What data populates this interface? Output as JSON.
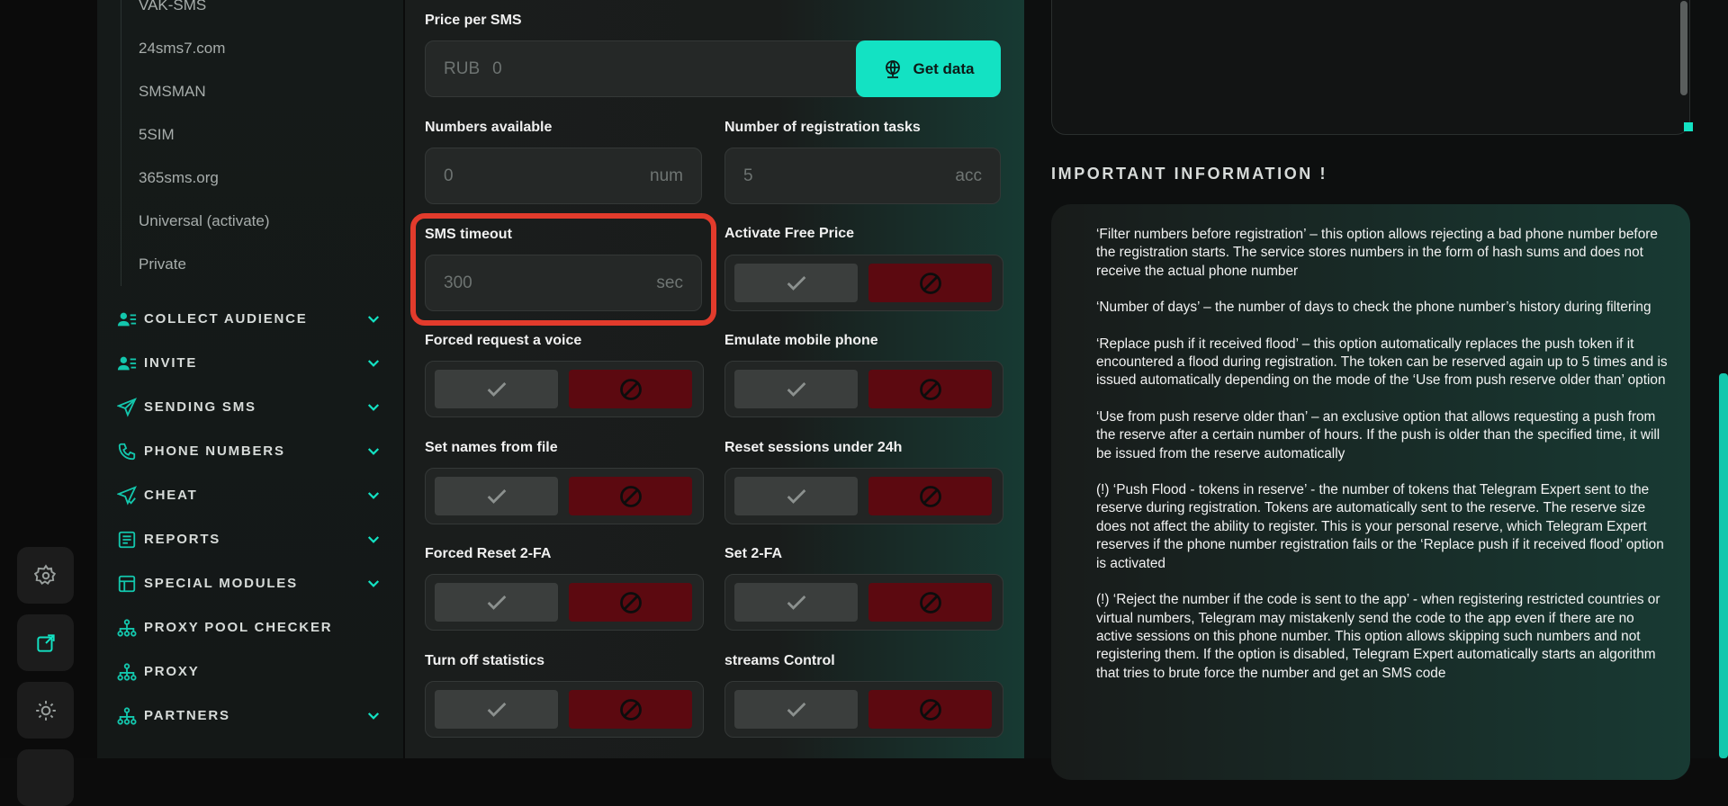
{
  "sidebar": {
    "sub_items": [
      "VAK-SMS",
      "24sms7.com",
      "SMSMAN",
      "5SIM",
      "365sms.org",
      "Universal (activate)",
      "Private"
    ],
    "menu": [
      {
        "label": "COLLECT AUDIENCE",
        "icon": "users-icon",
        "chevron": true
      },
      {
        "label": "INVITE",
        "icon": "users-icon",
        "chevron": true
      },
      {
        "label": "SENDING SMS",
        "icon": "send-icon",
        "chevron": true
      },
      {
        "label": "PHONE NUMBERS",
        "icon": "phone-icon",
        "chevron": true
      },
      {
        "label": "CHEAT",
        "icon": "send-check-icon",
        "chevron": true
      },
      {
        "label": "REPORTS",
        "icon": "report-icon",
        "chevron": true
      },
      {
        "label": "SPECIAL MODULES",
        "icon": "modules-icon",
        "chevron": true
      },
      {
        "label": "PROXY POOL CHECKER",
        "icon": "network-icon",
        "chevron": false
      },
      {
        "label": "PROXY",
        "icon": "network-icon",
        "chevron": false
      },
      {
        "label": "PARTNERS",
        "icon": "network-icon",
        "chevron": true
      }
    ]
  },
  "form": {
    "price": {
      "label": "Price per SMS",
      "prefix": "RUB",
      "value": "0",
      "button": "Get data"
    },
    "numbers_available": {
      "label": "Numbers available",
      "value": "0",
      "unit": "num"
    },
    "registration_tasks": {
      "label": "Number of registration tasks",
      "value": "5",
      "unit": "acc"
    },
    "sms_timeout": {
      "label": "SMS timeout",
      "value": "300",
      "unit": "sec"
    },
    "toggles": {
      "activate_free_price": "Activate Free Price",
      "forced_voice": "Forced request a voice",
      "emulate_mobile": "Emulate mobile phone",
      "names_from_file": "Set names from file",
      "reset_sessions": "Reset sessions under 24h",
      "forced_reset_2fa": "Forced Reset 2-FA",
      "set_2fa": "Set 2-FA",
      "turn_off_stats": "Turn off statistics",
      "streams_control": "streams Control"
    }
  },
  "info": {
    "title": "IMPORTANT INFORMATION !",
    "paragraphs": [
      "‘Filter numbers before registration’ – this option allows rejecting a bad phone number before the registration starts. The service stores numbers in the form of hash sums and does not receive the actual phone number",
      "‘Number of days’ – the number of days to check the phone number’s history during filtering",
      "‘Replace push if it received flood’ – this option automatically replaces the push token if it encountered a flood during registration. The token can be reserved again up to 5 times and is issued automatically depending on the mode of the ‘Use from push reserve older than’ option",
      "‘Use from push reserve older than’ – an exclusive option that allows requesting a push from the reserve after a certain number of hours. If the push is older than the specified time, it will be issued from the reserve automatically",
      "(!) ‘Push Flood - tokens in reserve’ - the number of tokens that Telegram Expert sent to the reserve during registration. Tokens are automatically sent to the reserve. The reserve size does not affect the ability to register. This is your personal reserve, which Telegram Expert reserves if the phone number registration fails or the ‘Replace push if it received flood’ option is activated",
      "(!) ‘Reject the number if the code is sent to the app’ - when registering restricted countries or virtual numbers, Telegram may mistakenly send the code to the app even if there are no active sessions on this phone number. This option allows skipping such numbers and not registering them. If the option is disabled, Telegram Expert automatically starts an algorithm that tries to brute force the number and get an SMS code"
    ]
  },
  "colors": {
    "accent": "#13e2c3",
    "danger": "#5c0910",
    "highlight": "#e23b2c"
  }
}
